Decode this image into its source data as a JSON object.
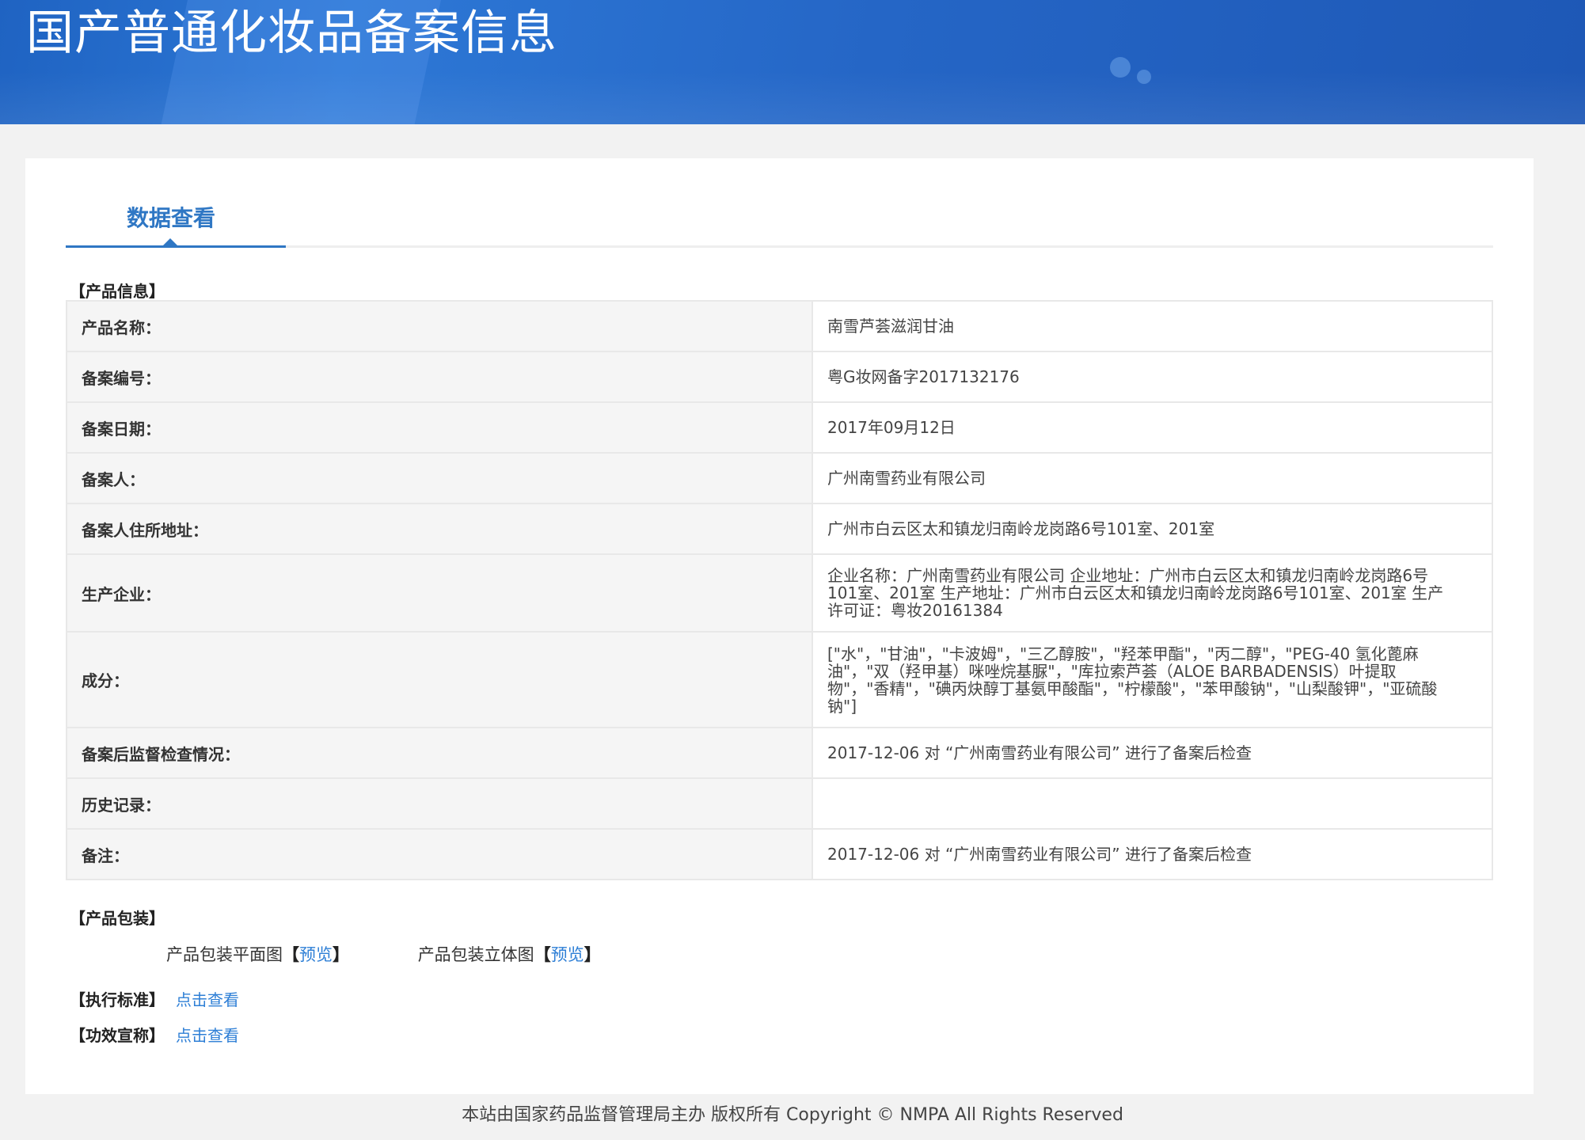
{
  "header": {
    "title": "国产普通化妆品备案信息"
  },
  "tabs": {
    "active_label": "数据查看"
  },
  "product_info": {
    "section_title": "【产品信息】",
    "rows": [
      {
        "label": "产品名称：",
        "value": "南雪芦荟滋润甘油"
      },
      {
        "label": "备案编号：",
        "value": "粤G妆网备字2017132176"
      },
      {
        "label": "备案日期：",
        "value": "2017年09月12日"
      },
      {
        "label": "备案人：",
        "value": "广州南雪药业有限公司"
      },
      {
        "label": "备案人住所地址：",
        "value": "广州市白云区太和镇龙归南岭龙岗路6号101室、201室"
      },
      {
        "label": "生产企业：",
        "value": "企业名称：广州南雪药业有限公司 企业地址：广州市白云区太和镇龙归南岭龙岗路6号101室、201室 生产地址：广州市白云区太和镇龙归南岭龙岗路6号101室、201室 生产许可证：粤妆20161384"
      },
      {
        "label": "成分：",
        "value": "[\"水\"，\"甘油\"，\"卡波姆\"，\"三乙醇胺\"，\"羟苯甲酯\"，\"丙二醇\"，\"PEG-40 氢化蓖麻油\"，\"双（羟甲基）咪唑烷基脲\"，\"库拉索芦荟（ALOE BARBADENSIS）叶提取物\"，\"香精\"，\"碘丙炔醇丁基氨甲酸酯\"，\"柠檬酸\"，\"苯甲酸钠\"，\"山梨酸钾\"，\"亚硫酸钠\"]"
      },
      {
        "label": "备案后监督检查情况：",
        "value": "2017-12-06 对 “广州南雪药业有限公司” 进行了备案后检查"
      },
      {
        "label": "历史记录：",
        "value": ""
      },
      {
        "label": "备注：",
        "value": "2017-12-06 对 “广州南雪药业有限公司” 进行了备案后检查"
      }
    ]
  },
  "packaging": {
    "section_title": "【产品包装】",
    "flat_label": "产品包装平面图",
    "solid_label": "产品包装立体图",
    "bracket_open": "【",
    "bracket_close": "】",
    "preview_link": "预览"
  },
  "standards": {
    "label": "【执行标准】",
    "link": "点击查看"
  },
  "efficacy": {
    "label": "【功效宣称】",
    "link": "点击查看"
  },
  "footer": {
    "text": "本站由国家药品监督管理局主办 版权所有 Copyright © NMPA All Rights Reserved"
  }
}
